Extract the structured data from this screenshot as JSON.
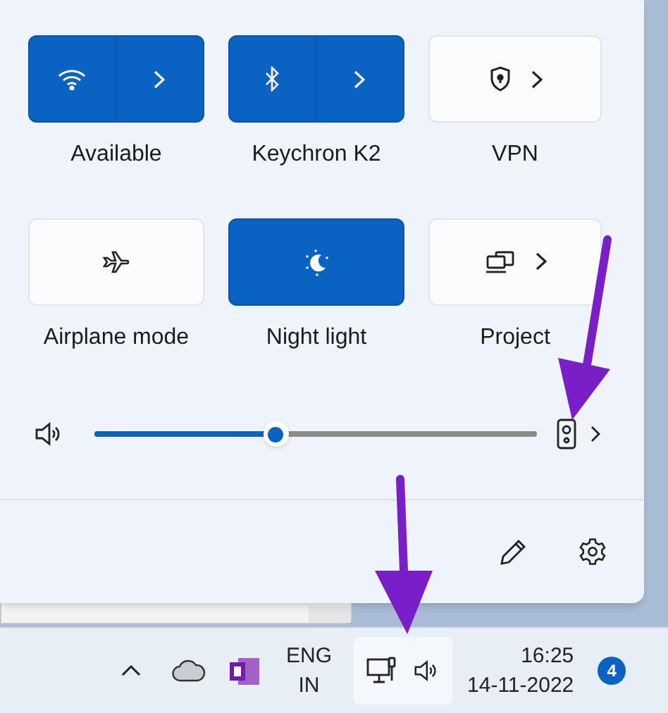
{
  "quick_settings": {
    "tiles": [
      {
        "kind": "split",
        "label": "Available",
        "on": true
      },
      {
        "kind": "split",
        "label": "Keychron K2",
        "on": true
      },
      {
        "kind": "menu",
        "label": "VPN",
        "on": false
      },
      {
        "kind": "toggle",
        "label": "Airplane mode",
        "on": false
      },
      {
        "kind": "toggle",
        "label": "Night light",
        "on": true
      },
      {
        "kind": "menu",
        "label": "Project",
        "on": false
      }
    ],
    "volume": {
      "level": 0.41
    }
  },
  "taskbar": {
    "language": {
      "line_1": "ENG",
      "line_2": "IN"
    },
    "time": "16:25",
    "date": "14-11-2022",
    "notification_count": "4"
  }
}
